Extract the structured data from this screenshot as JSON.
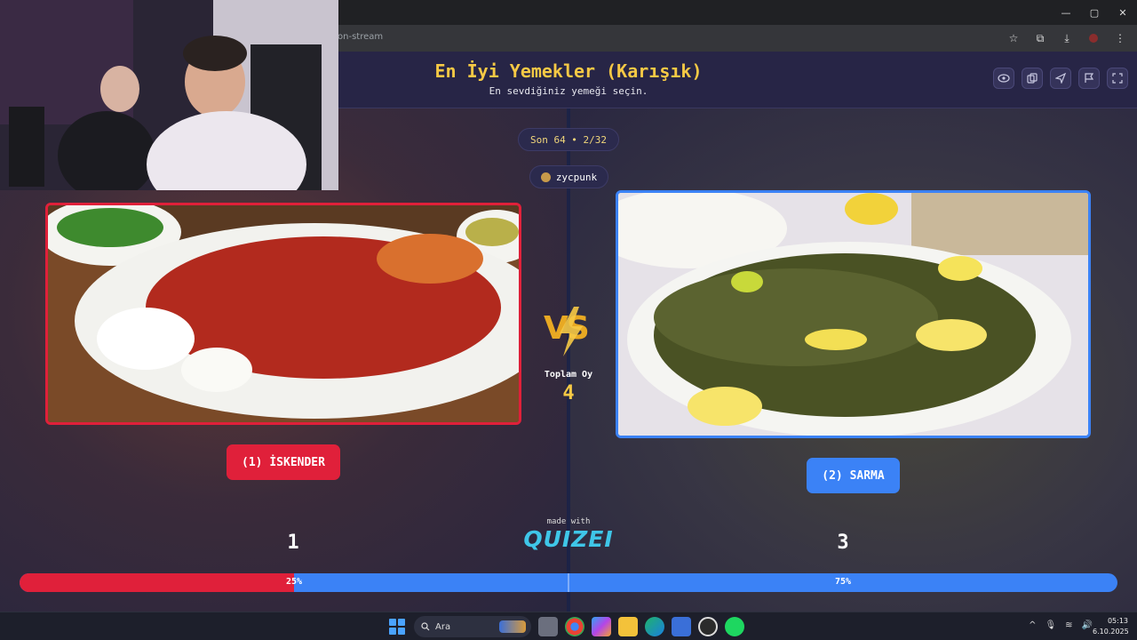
{
  "browser": {
    "url": "on-stream",
    "window_controls": [
      "—",
      "▢",
      "✕"
    ],
    "toolbar_icons": [
      "star-icon",
      "extensions-icon",
      "download-icon",
      "menu-icon"
    ]
  },
  "header": {
    "title": "En İyi Yemekler (Karışık)",
    "subtitle": "En sevdiğiniz yemeği seçin.",
    "buttons": [
      "eye-icon",
      "copy-icon",
      "send-icon",
      "flag-icon",
      "fullscreen-icon"
    ]
  },
  "round": {
    "label": "Son 64 • 2/32"
  },
  "user": {
    "name": "zycpunk"
  },
  "versus": {
    "vs_label": "VS",
    "total_label": "Toplam Oy",
    "total_votes": "4"
  },
  "options": [
    {
      "button_label": "(1) İSKENDER",
      "votes": "1",
      "percent": "25%",
      "color": "#e0203a"
    },
    {
      "button_label": "(2) SARMA",
      "votes": "3",
      "percent": "75%",
      "color": "#3b82f6"
    }
  ],
  "progress": {
    "left_fraction": 0.25,
    "right_fraction": 0.75
  },
  "footer": {
    "made_with": "made with",
    "brand": "QUIZEI"
  },
  "taskbar": {
    "search_placeholder": "Ara",
    "time": "05:13",
    "date": "6.10.2025",
    "apps": [
      "file-explorer-icon",
      "chrome-icon",
      "copilot-icon",
      "folder-icon",
      "edge-icon",
      "store-icon",
      "obs-icon",
      "spotify-icon"
    ]
  }
}
